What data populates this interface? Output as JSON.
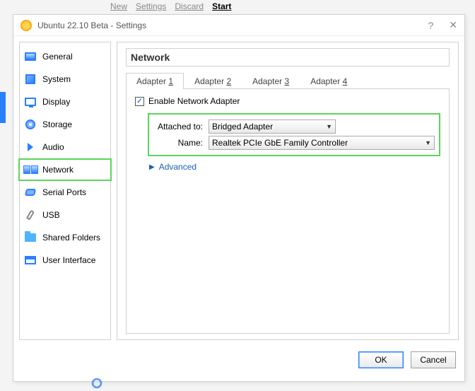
{
  "topmenu": {
    "new": "New",
    "settings": "Settings",
    "discard": "Discard",
    "start": "Start"
  },
  "window": {
    "title": "Ubuntu 22.10 Beta - Settings"
  },
  "sidebar": {
    "items": [
      {
        "label": "General"
      },
      {
        "label": "System"
      },
      {
        "label": "Display"
      },
      {
        "label": "Storage"
      },
      {
        "label": "Audio"
      },
      {
        "label": "Network"
      },
      {
        "label": "Serial Ports"
      },
      {
        "label": "USB"
      },
      {
        "label": "Shared Folders"
      },
      {
        "label": "User Interface"
      }
    ],
    "selected": "Network"
  },
  "main": {
    "heading": "Network",
    "tabs": [
      {
        "label_prefix": "Adapter ",
        "num": "1"
      },
      {
        "label_prefix": "Adapter ",
        "num": "2"
      },
      {
        "label_prefix": "Adapter ",
        "num": "3"
      },
      {
        "label_prefix": "Adapter ",
        "num": "4"
      }
    ],
    "active_tab": 0,
    "enable_label": "Enable Network Adapter",
    "enable_checked": true,
    "attached_label": "Attached to:",
    "attached_value": "Bridged Adapter",
    "name_label": "Name:",
    "name_value": "Realtek PCIe GbE Family Controller",
    "advanced_label": "Advanced"
  },
  "buttons": {
    "ok": "OK",
    "cancel": "Cancel"
  }
}
